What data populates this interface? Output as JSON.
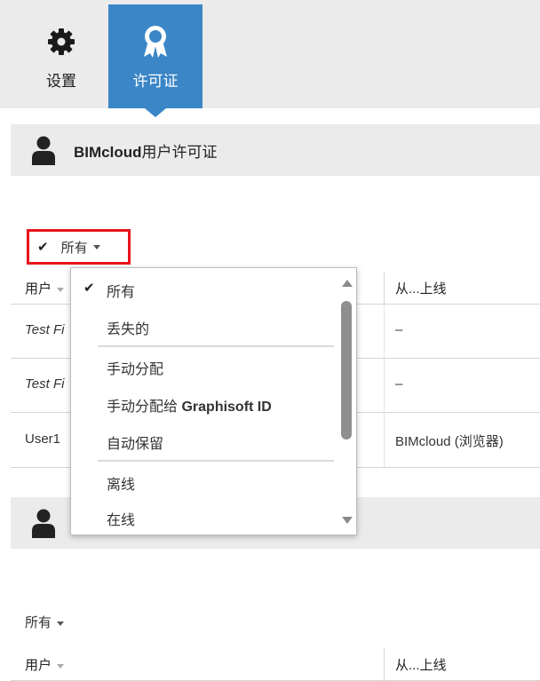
{
  "tabs": [
    {
      "label": "设置",
      "icon": "gear-icon"
    },
    {
      "label": "许可证",
      "icon": "award-ribbon-icon"
    }
  ],
  "colors": {
    "accent": "#3a86c7",
    "highlight_border": "#e8141c",
    "header_bg": "#ebebeb"
  },
  "section1": {
    "title_bold": "BIMcloud",
    "title_rest": "用户许可证",
    "icon": "person-icon",
    "filter": {
      "check": "✔",
      "label": "所有"
    },
    "columns": {
      "user": "用户",
      "online_from": "从...上线"
    },
    "rows": [
      {
        "user": "Test Fi",
        "online": "–"
      },
      {
        "user": "Test Fi",
        "online": "–"
      },
      {
        "user": "User1",
        "online": "BIMcloud (浏览器)"
      }
    ]
  },
  "dropdown": {
    "check": "✔",
    "items": [
      "所有",
      "丢失的",
      "手动分配",
      "手动分配给",
      "自动保留",
      "离线",
      "在线"
    ],
    "graphisoft_id": "Graphisoft ID"
  },
  "section2": {
    "icon": "person-icon",
    "filter_label": "所有",
    "columns": {
      "user": "用户",
      "online_from": "从...上线"
    }
  }
}
